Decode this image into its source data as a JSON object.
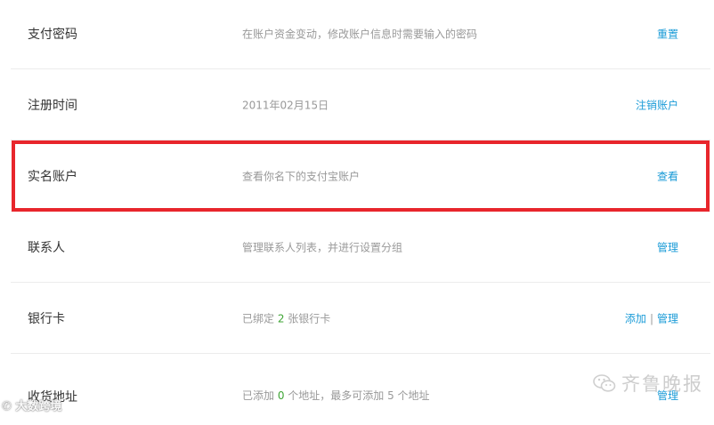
{
  "rows": [
    {
      "label": "支付密码",
      "desc": "在账户资金变动，修改账户信息时需要输入的密码",
      "actions": [
        "重置"
      ]
    },
    {
      "label": "注册时间",
      "desc": "2011年02月15日",
      "actions": [
        "注销账户"
      ]
    },
    {
      "label": "实名账户",
      "desc": "查看你名下的支付宝账户",
      "actions": [
        "查看"
      ]
    },
    {
      "label": "联系人",
      "desc": "管理联系人列表，并进行设置分组",
      "actions": [
        "管理"
      ]
    },
    {
      "label": "银行卡",
      "desc_prefix": "已绑定 ",
      "desc_count": "2",
      "desc_suffix": " 张银行卡",
      "actions": [
        "添加",
        "管理"
      ],
      "separator": "|"
    },
    {
      "label": "收货地址",
      "desc_prefix": "已添加 ",
      "desc_count": "0",
      "desc_suffix": " 个地址，最多可添加 5 个地址",
      "actions": [
        "管理"
      ]
    }
  ],
  "colors": {
    "highlight": "#e8262c",
    "link": "#1a9bd7",
    "count": "#3fa535"
  },
  "watermarks": {
    "left": "大数跨境",
    "right": "齐鲁晚报"
  }
}
